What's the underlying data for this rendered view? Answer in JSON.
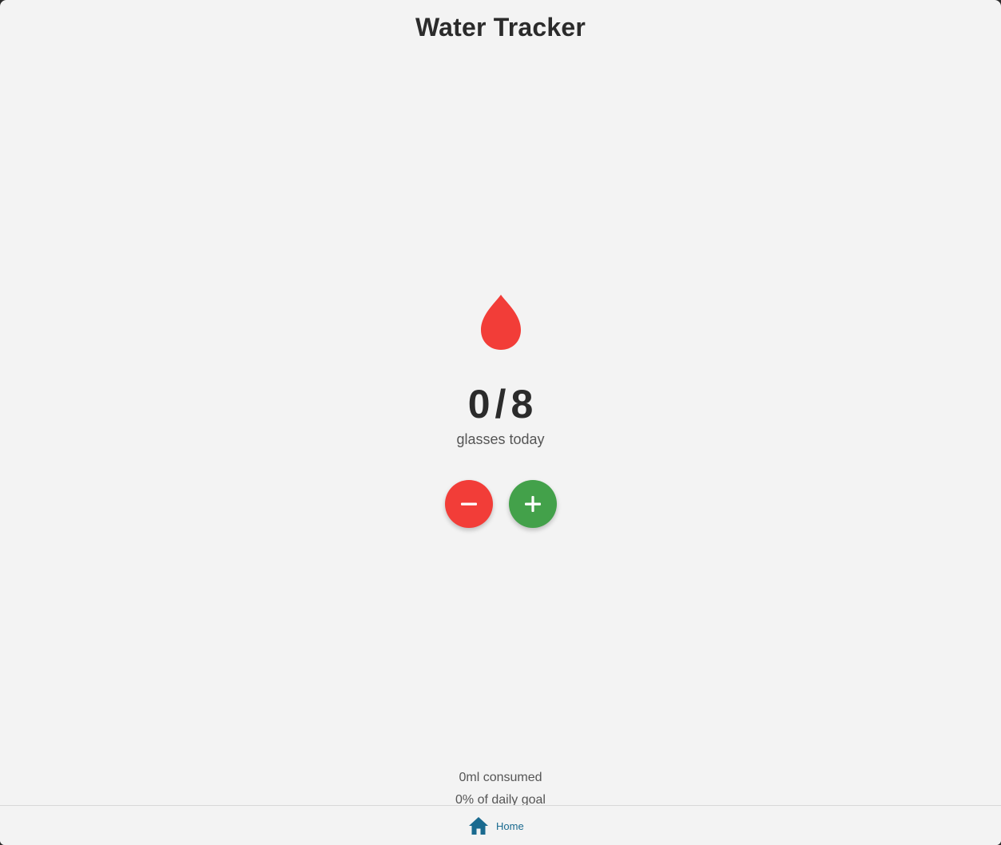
{
  "app": {
    "title": "Water Tracker"
  },
  "tracker": {
    "icon": "water-drop-icon",
    "current": "0",
    "separator": "/",
    "goal": "8",
    "caption": "glasses today",
    "decrement_icon": "minus-icon",
    "increment_icon": "plus-icon"
  },
  "summary": {
    "consumed": "0ml consumed",
    "goal_percent": "0% of daily goal"
  },
  "nav": {
    "items": [
      {
        "icon": "home-icon",
        "label": "Home",
        "active": true
      }
    ]
  },
  "colors": {
    "drop": "#f23d38",
    "decrement": "#f23d38",
    "increment": "#43a14a",
    "nav_active": "#1a6a8f",
    "background": "#f3f3f3"
  }
}
